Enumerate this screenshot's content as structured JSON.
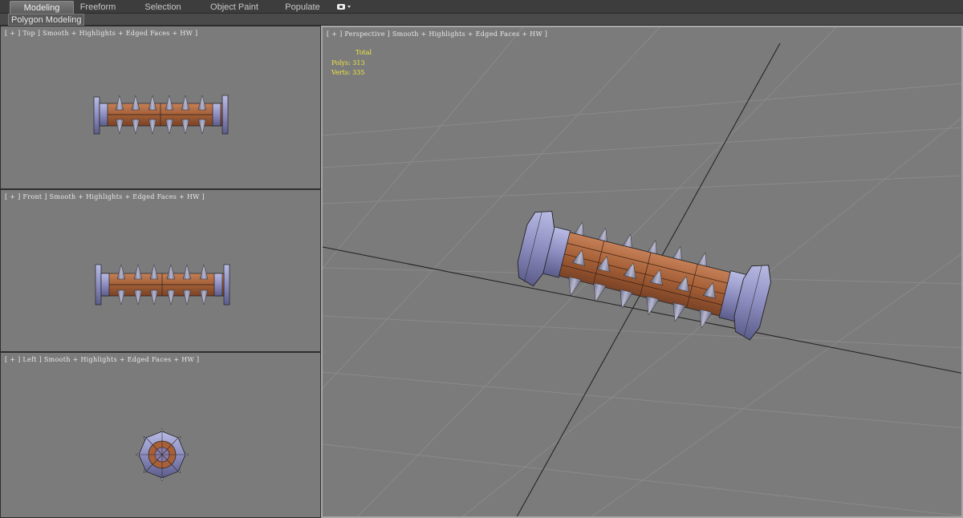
{
  "ribbon": {
    "tabs": [
      {
        "label": "Modeling",
        "active": true
      },
      {
        "label": "Freeform",
        "active": false
      },
      {
        "label": "Selection",
        "active": false
      },
      {
        "label": "Object Paint",
        "active": false
      },
      {
        "label": "Populate",
        "active": false
      }
    ],
    "panel_label": "Polygon Modeling"
  },
  "viewports": {
    "top": {
      "label": "[ + ] Top ] Smooth + Highlights + Edged Faces + HW ]"
    },
    "front": {
      "label": "[ + ] Front ] Smooth + Highlights + Edged Faces + HW ]"
    },
    "left": {
      "label": "[ + ] Left ] Smooth + Highlights + Edged Faces + HW ]"
    },
    "perspective": {
      "label": "[ + ] Perspective ] Smooth + Highlights + Edged Faces + HW ]",
      "stats": {
        "header": "Total",
        "polys": "Polys: 313",
        "verts": "Verts: 335"
      }
    }
  },
  "colors": {
    "viewport_bg": "#7b7b7b",
    "wood": "#a4643a",
    "metal": "#8d8ec0",
    "stats_text": "#f0e640",
    "active_border": "#a8a8a8"
  },
  "icons": [
    "viewport-options-icon",
    "spiked-roller-model"
  ]
}
